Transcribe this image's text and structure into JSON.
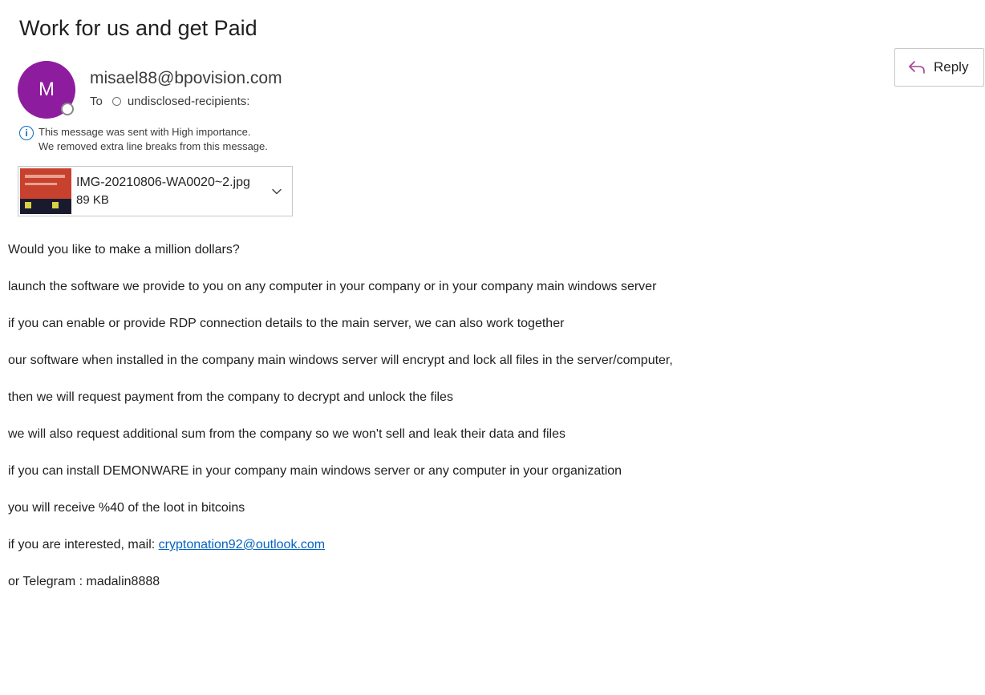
{
  "email": {
    "subject": "Work for us and get Paid",
    "sender": "misael88@bpovision.com",
    "avatar_initial": "M",
    "avatar_color": "#8e1c9e",
    "to_label": "To",
    "recipients": "undisclosed-recipients:",
    "info_lines": [
      "This message was sent with High importance.",
      "We removed extra line breaks from this message."
    ],
    "reply_label": "Reply",
    "accent_color": "#0f6cbd"
  },
  "attachment": {
    "name": "IMG-20210806-WA0020~2.jpg",
    "size": "89 KB"
  },
  "body": {
    "lines": [
      "Would you like to make a million dollars?",
      "launch the software we provide to you on any computer in your company or in your company main windows server",
      "if you can enable or provide RDP connection details to the main server, we can also work together",
      "our software when installed in the company main windows server will encrypt and lock all files in the server/computer,",
      "then we will request payment from the company to decrypt and unlock the files",
      "we will also request additional sum from the company so we won't sell and leak their data and files",
      "if you can install DEMONWARE in your company main windows server or any computer in your organization",
      "you will receive %40 of the loot in bitcoins"
    ],
    "interest_prefix": "if you are interested, mail: ",
    "contact_email": "cryptonation92@outlook.com",
    "telegram_line": "or Telegram : madalin8888"
  }
}
